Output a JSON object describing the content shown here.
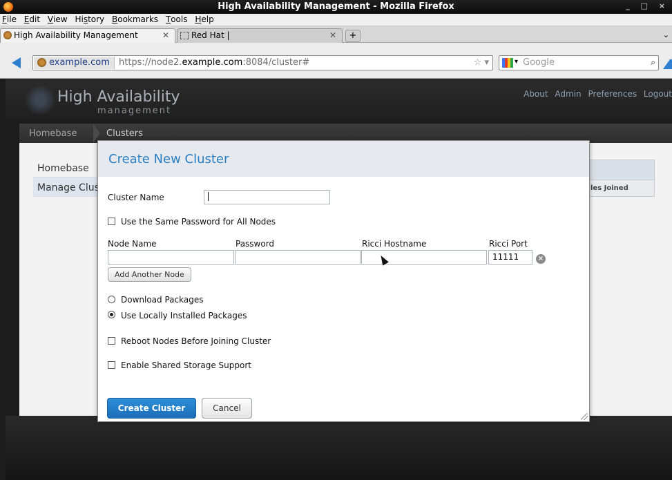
{
  "window": {
    "title": "High Availability Management - Mozilla Firefox",
    "controls": "_ □ ×"
  },
  "menu": {
    "items": [
      {
        "label": "File",
        "key": "F",
        "rest": "ile"
      },
      {
        "label": "Edit",
        "key": "E",
        "rest": "dit"
      },
      {
        "label": "View",
        "key": "V",
        "rest": "iew"
      },
      {
        "label": "History",
        "pre": "Hi",
        "key": "s",
        "rest": "tory"
      },
      {
        "label": "Bookmarks",
        "key": "B",
        "rest": "ookmarks"
      },
      {
        "label": "Tools",
        "key": "T",
        "rest": "ools"
      },
      {
        "label": "Help",
        "key": "H",
        "rest": "elp"
      }
    ]
  },
  "tabs": [
    {
      "label": "High Availability Management",
      "close": "✕",
      "active": true
    },
    {
      "label": "Red Hat |",
      "close": "✕",
      "active": false
    }
  ],
  "newtab_icon": "plus-icon",
  "nav": {
    "identity": "example.com",
    "url_prefix": "https://node2.",
    "url_host": "example.com",
    "url_suffix": ":8084/cluster#",
    "url_tools": "☆ ▾",
    "search_placeholder": "Google"
  },
  "app": {
    "logo_main": "High Availability",
    "logo_sub": "management",
    "top_links": [
      "About",
      "Admin",
      "Preferences",
      "Logout"
    ],
    "breadcrumb": [
      "Homebase",
      "Clusters"
    ],
    "side_nav": [
      "Homebase",
      "Manage Clus"
    ],
    "table_col": "les Joined"
  },
  "dialog": {
    "title": "Create New Cluster",
    "cluster_name_label": "Cluster Name",
    "cluster_name_value": "",
    "same_password_label": "Use the Same Password for All Nodes",
    "same_password_checked": false,
    "columns": {
      "node_name": "Node Name",
      "password": "Password",
      "ricci_hostname": "Ricci Hostname",
      "ricci_port": "Ricci Port"
    },
    "node_row": {
      "node_name": "",
      "password": "",
      "ricci_hostname": "",
      "ricci_port": "11111"
    },
    "add_node_label": "Add Another Node",
    "download_packages_label": "Download Packages",
    "local_packages_label": "Use Locally Installed Packages",
    "selected_package_option": "Use Locally Installed Packages",
    "reboot_label": "Reboot Nodes Before Joining Cluster",
    "reboot_checked": false,
    "shared_storage_label": "Enable Shared Storage Support",
    "shared_storage_checked": false,
    "create_label": "Create Cluster",
    "cancel_label": "Cancel",
    "remove_icon": "close-circle-icon"
  },
  "colors": {
    "primary_button": "#1c6db8",
    "dialog_title": "#2a7fc4",
    "page_bg": "#1c1c1c"
  }
}
